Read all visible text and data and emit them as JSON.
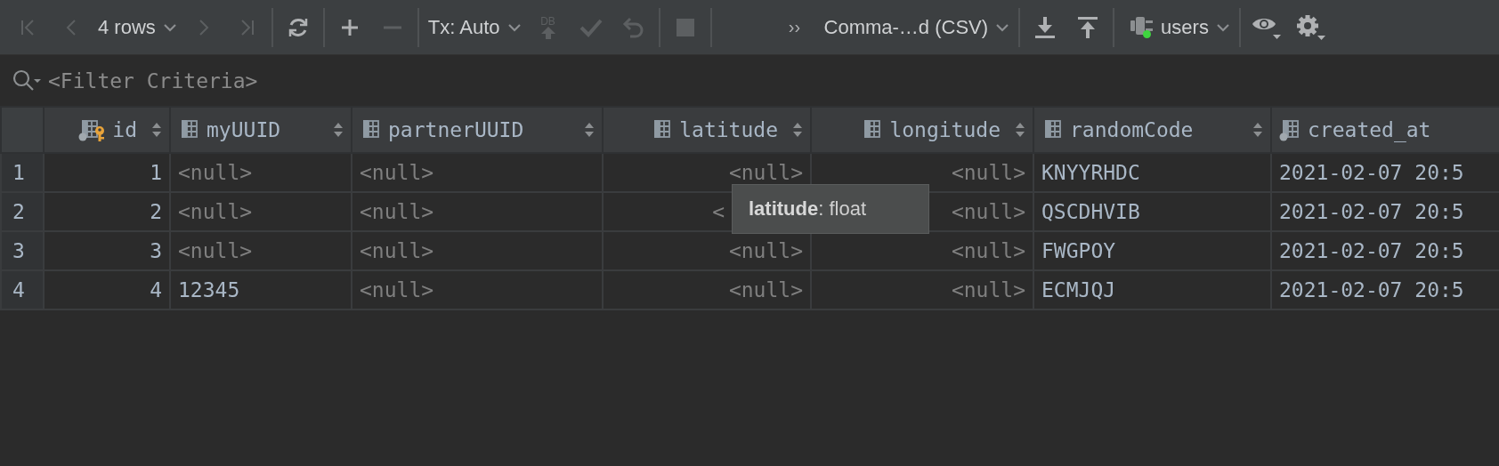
{
  "toolbar": [
    {
      "kind": "first",
      "disabled": true
    },
    {
      "kind": "prev",
      "disabled": true
    },
    {
      "kind": "dropdown",
      "label": "4 rows",
      "disabled": false
    },
    {
      "kind": "next",
      "disabled": true
    },
    {
      "kind": "last",
      "disabled": true
    },
    {
      "kind": "sep"
    },
    {
      "kind": "refresh",
      "disabled": false
    },
    {
      "kind": "sep"
    },
    {
      "kind": "add",
      "disabled": false
    },
    {
      "kind": "remove",
      "disabled": true
    },
    {
      "kind": "sep"
    },
    {
      "kind": "dropdown",
      "label": "Tx: Auto",
      "disabled": false
    },
    {
      "kind": "commit",
      "label": "DB",
      "disabled": true
    },
    {
      "kind": "apply",
      "disabled": true
    },
    {
      "kind": "revert",
      "disabled": true
    },
    {
      "kind": "sep"
    },
    {
      "kind": "stop",
      "disabled": true
    },
    {
      "kind": "sep"
    },
    {
      "kind": "more",
      "label": "››",
      "disabled": false
    },
    {
      "kind": "dropdown",
      "label": "Comma-…d (CSV)",
      "disabled": false
    },
    {
      "kind": "sep"
    },
    {
      "kind": "download",
      "disabled": false
    },
    {
      "kind": "upload",
      "disabled": false
    },
    {
      "kind": "sep"
    },
    {
      "kind": "datasource",
      "label": "users",
      "connected": true,
      "disabled": false
    },
    {
      "kind": "sep"
    },
    {
      "kind": "view",
      "disabled": false
    },
    {
      "kind": "settings",
      "disabled": false
    }
  ],
  "filter": {
    "placeholder": "<Filter Criteria>"
  },
  "table": {
    "columns": [
      {
        "name": "id",
        "kind": "number",
        "key": true,
        "not_null": true,
        "sortable": true
      },
      {
        "name": "myUUID",
        "kind": "text",
        "key": false,
        "not_null": false,
        "sortable": true
      },
      {
        "name": "partnerUUID",
        "kind": "text",
        "key": false,
        "not_null": false,
        "sortable": true
      },
      {
        "name": "latitude",
        "kind": "number",
        "key": false,
        "not_null": false,
        "sortable": true
      },
      {
        "name": "longitude",
        "kind": "number",
        "key": false,
        "not_null": false,
        "sortable": true
      },
      {
        "name": "randomCode",
        "kind": "text",
        "key": false,
        "not_null": false,
        "sortable": true
      },
      {
        "name": "created_at",
        "kind": "text",
        "key": false,
        "not_null": true,
        "sortable": false
      }
    ],
    "rows": [
      {
        "number": "1",
        "cells": [
          {
            "text": "1",
            "null": false
          },
          {
            "text": "<null>",
            "null": true
          },
          {
            "text": "<null>",
            "null": true
          },
          {
            "text": "<null>",
            "null": true
          },
          {
            "text": "<null>",
            "null": true
          },
          {
            "text": "KNYYRHDC",
            "null": false
          },
          {
            "text": "2021-02-07 20:5",
            "null": false
          }
        ]
      },
      {
        "number": "2",
        "cells": [
          {
            "text": "2",
            "null": false
          },
          {
            "text": "<null>",
            "null": true
          },
          {
            "text": "<null>",
            "null": true
          },
          {
            "text": "<",
            "null": true,
            "covered": true
          },
          {
            "text": "<null>",
            "null": true
          },
          {
            "text": "QSCDHVIB",
            "null": false
          },
          {
            "text": "2021-02-07 20:5",
            "null": false
          }
        ]
      },
      {
        "number": "3",
        "cells": [
          {
            "text": "3",
            "null": false
          },
          {
            "text": "<null>",
            "null": true
          },
          {
            "text": "<null>",
            "null": true
          },
          {
            "text": "<null>",
            "null": true
          },
          {
            "text": "<null>",
            "null": true
          },
          {
            "text": "FWGPOY",
            "null": false
          },
          {
            "text": "2021-02-07 20:5",
            "null": false
          }
        ]
      },
      {
        "number": "4",
        "cells": [
          {
            "text": "4",
            "null": false
          },
          {
            "text": "12345",
            "null": false
          },
          {
            "text": "<null>",
            "null": true
          },
          {
            "text": "<null>",
            "null": true
          },
          {
            "text": "<null>",
            "null": true
          },
          {
            "text": "ECMJQJ",
            "null": false
          },
          {
            "text": "2021-02-07 20:5",
            "null": false
          }
        ]
      }
    ]
  },
  "tooltip": {
    "text": "**latitude**: float"
  }
}
